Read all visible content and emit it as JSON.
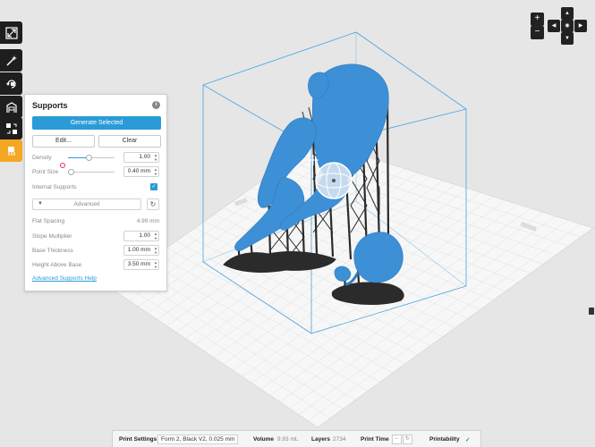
{
  "panel": {
    "title": "Supports",
    "generate_label": "Generate Selected",
    "edit_label": "Edit...",
    "clear_label": "Clear",
    "density_label": "Density",
    "density_value": "1.00",
    "density_fraction": 0.45,
    "point_size_label": "Point Size",
    "point_size_value": "0.40 mm",
    "point_size_fraction": 0.05,
    "internal_supports_label": "Internal Supports",
    "internal_supports_checked": true,
    "advanced_label": "Advanced",
    "flat_spacing_label": "Flat Spacing",
    "flat_spacing_value": "4.99 mm",
    "slope_multiplier_label": "Slope Multiplier",
    "slope_multiplier_value": "1.00",
    "base_thickness_label": "Base Thickness",
    "base_thickness_value": "1.00 mm",
    "height_above_base_label": "Height Above Base",
    "height_above_base_value": "3.50 mm",
    "help_link": "Advanced Supports Help"
  },
  "status": {
    "print_settings_label": "Print Settings",
    "print_settings_value": "Form 2, Black V2, 0.025 mm",
    "volume_label": "Volume",
    "volume_value": "9.93 mL",
    "layers_label": "Layers",
    "layers_value": "2734",
    "print_time_label": "Print Time",
    "print_time_value": "--",
    "printability_label": "Printability"
  },
  "view": {
    "zoom_in": "+",
    "zoom_out": "−",
    "nav_up": "▲",
    "nav_down": "▼",
    "nav_left": "◀",
    "nav_right": "▶"
  },
  "colors": {
    "model": "#3d8fd6",
    "supports": "#2b2b2b",
    "accent": "#2b9bd8",
    "tool_active": "#f5a623"
  }
}
